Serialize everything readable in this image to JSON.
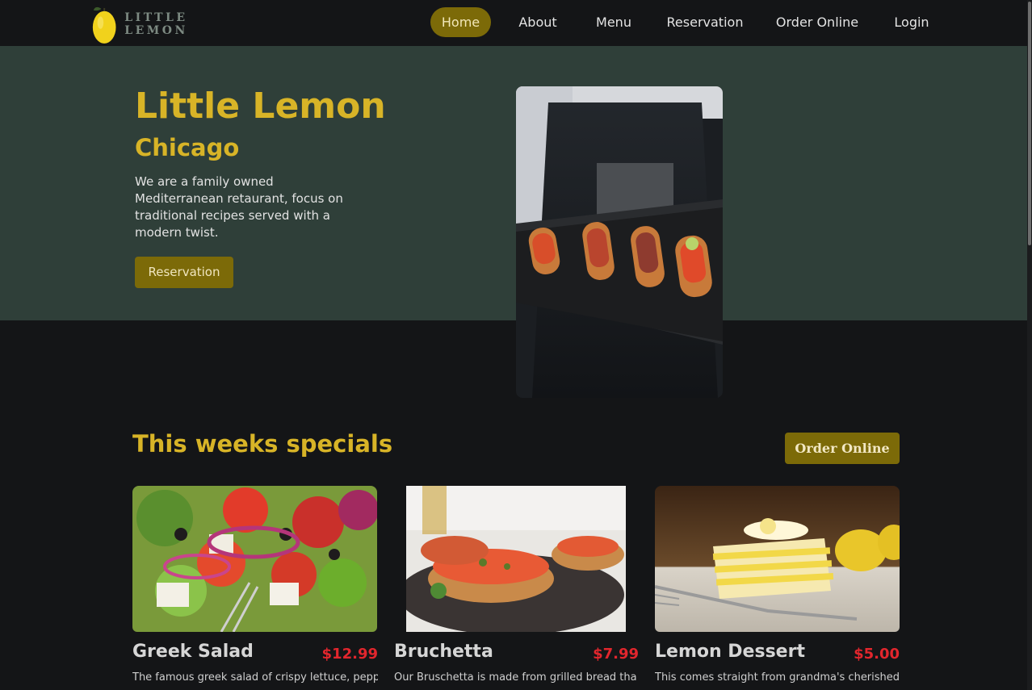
{
  "brand": {
    "name": "LITTLE LEMON"
  },
  "nav": {
    "items": [
      {
        "label": "Home",
        "active": true
      },
      {
        "label": "About"
      },
      {
        "label": "Menu"
      },
      {
        "label": "Reservation"
      },
      {
        "label": "Order Online"
      },
      {
        "label": "Login"
      }
    ]
  },
  "hero": {
    "title": "Little Lemon",
    "city": "Chicago",
    "description": "We are a family owned Mediterranean retaurant, focus on traditional recipes served with a modern twist.",
    "button_label": "Reservation"
  },
  "specials": {
    "title": "This weeks specials",
    "order_button": "Order Online",
    "items": [
      {
        "name": "Greek Salad",
        "price": "$12.99",
        "description": "The famous greek salad of crispy lettuce, peppers,"
      },
      {
        "name": "Bruchetta",
        "price": "$7.99",
        "description": "Our Bruschetta is made from grilled bread that"
      },
      {
        "name": "Lemon Dessert",
        "price": "$5.00",
        "description": "This comes straight from grandma's cherished"
      }
    ]
  },
  "colors": {
    "accent": "#7c6a08",
    "title_yellow": "#d8b427",
    "hero_bg": "#2f3f39",
    "page_bg": "#141517",
    "price_red": "#e2262d"
  }
}
